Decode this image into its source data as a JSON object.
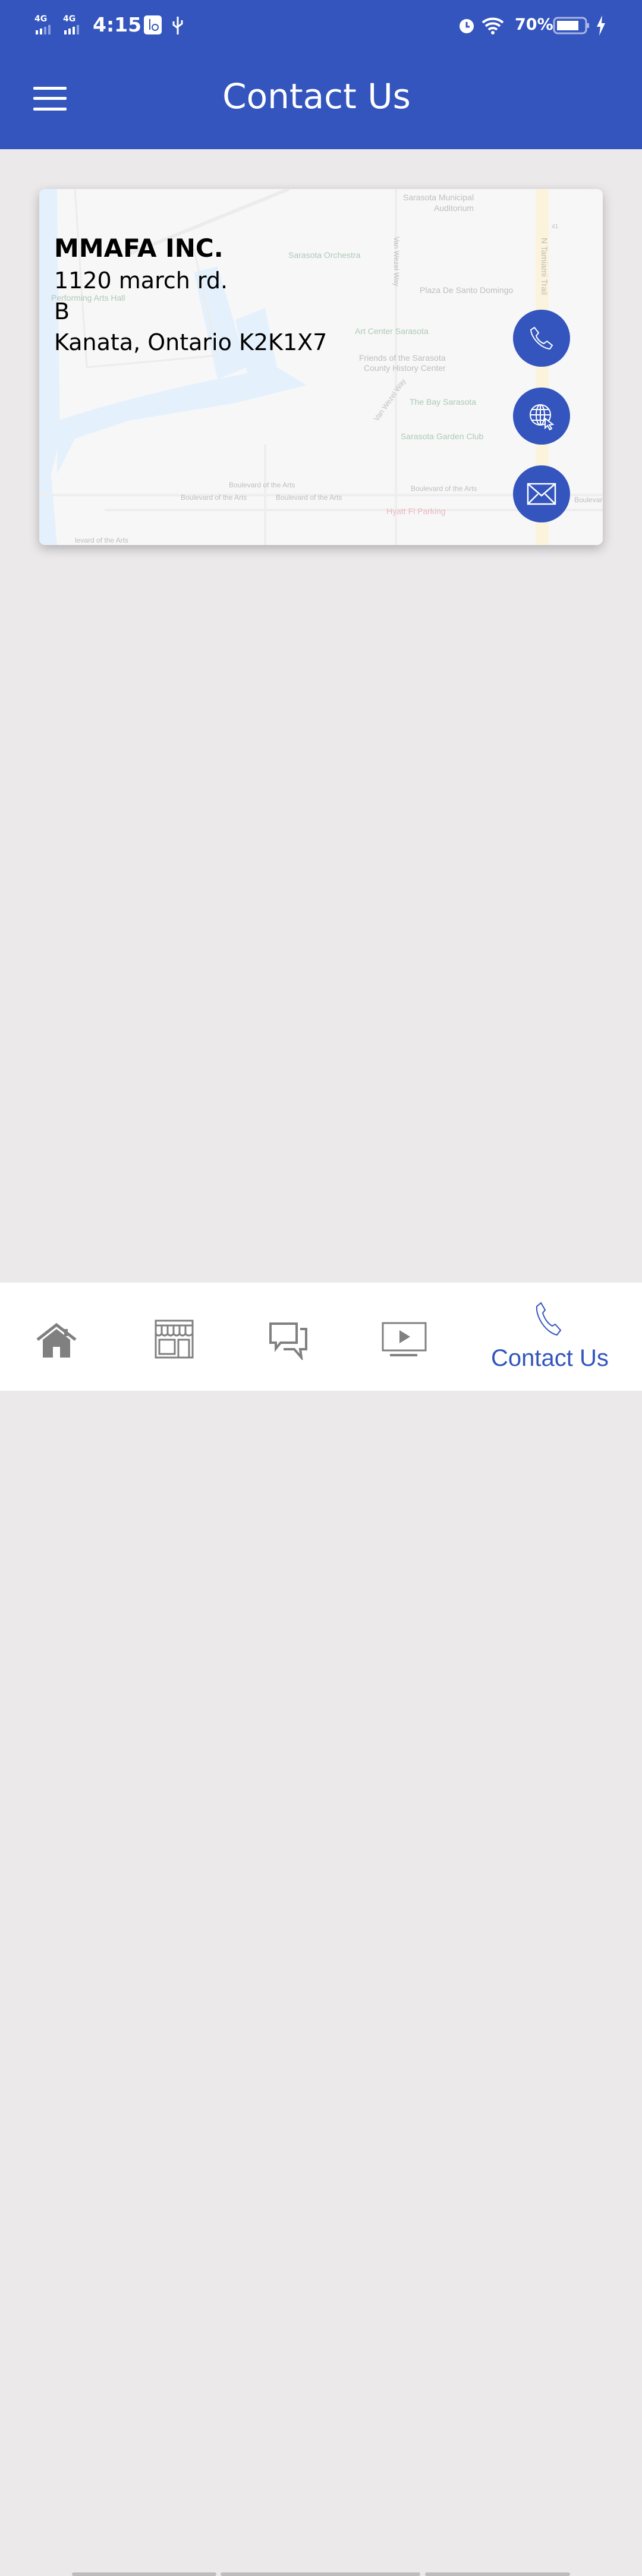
{
  "status_bar": {
    "network_1": "4G",
    "network_2": "4G",
    "time": "4:15",
    "battery": "70%",
    "icons": [
      "signal-icon",
      "signal-icon",
      "usb-settings-icon",
      "usb-icon",
      "alarm-icon",
      "wifi-icon",
      "battery-icon",
      "charging-icon"
    ]
  },
  "header": {
    "title": "Contact Us",
    "menu_icon": "hamburger-icon"
  },
  "contact_card": {
    "name": "MMAFA INC.",
    "address_line1": "1120 march rd.",
    "address_line2": "B",
    "address_line3": "Kanata, Ontario K2K1X7",
    "actions": [
      {
        "icon": "phone-icon"
      },
      {
        "icon": "globe-icon"
      },
      {
        "icon": "mail-icon"
      }
    ],
    "map_labels": {
      "municipal": "Sarasota Municipal",
      "auditorium": "Auditorium",
      "orchestra": "Sarasota Orchestra",
      "van_wezel_1": "Van Wezel Way",
      "plaza": "Plaza De Santo Domingo",
      "performing": "Performing Arts Hall",
      "art_center": "Art Center Sarasota",
      "friends_1": "Friends of the Sarasota",
      "friends_2": "County History Center",
      "van_wezel_2": "Van Wezel Way",
      "bay": "The Bay Sarasota",
      "garden": "Sarasota Garden Club",
      "tamiami": "N Tamiami Trail",
      "boulevard_1": "Boulevard of the Arts",
      "boulevard_2": "Boulevard of the Arts",
      "boulevard_3": "Boulevard of the Arts",
      "boulevard_4": "Boulevard of the Arts",
      "boulevard_5": "Boulevard",
      "boulevard_6": "levard of the Arts",
      "parking": "Hyatt Fl Parking",
      "route": "41"
    }
  },
  "bottom_nav": {
    "items": [
      {
        "icon": "home-icon"
      },
      {
        "icon": "store-icon"
      },
      {
        "icon": "chat-icon"
      },
      {
        "icon": "video-icon"
      },
      {
        "icon": "phone-icon",
        "label": "Contact Us",
        "active": true
      }
    ],
    "active_color": "#3355bd",
    "inactive_color": "#808080"
  },
  "colors": {
    "brand": "#3355bd",
    "background": "#ebe9ea"
  }
}
